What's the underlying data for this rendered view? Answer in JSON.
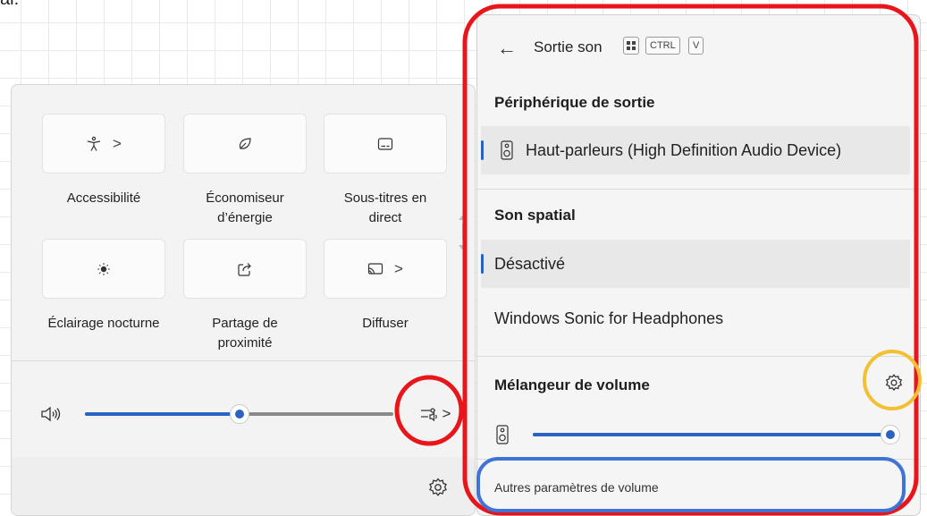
{
  "top_text": "al.",
  "quick_settings": {
    "tiles": [
      {
        "label": "Accessibilité",
        "has_chevron": true,
        "icon": "accessibility-icon"
      },
      {
        "label": "Économiseur d’énergie",
        "has_chevron": false,
        "icon": "leaf-icon"
      },
      {
        "label": "Sous-titres en direct",
        "has_chevron": false,
        "icon": "captions-icon"
      },
      {
        "label": "Éclairage nocturne",
        "has_chevron": false,
        "icon": "brightness-icon"
      },
      {
        "label": "Partage de proximité",
        "has_chevron": false,
        "icon": "share-icon"
      },
      {
        "label": "Diffuser",
        "has_chevron": true,
        "icon": "cast-icon"
      }
    ],
    "chevron": ">",
    "volume": {
      "level": 0.5,
      "icon": "speaker-icon"
    },
    "mixer_chevron": ">"
  },
  "sound_flyout": {
    "back_glyph": "←",
    "title": "Sortie son",
    "shortcut_keys": [
      "CTRL",
      "V"
    ],
    "output_section": "Périphérique de sortie",
    "output_devices": [
      {
        "label": "Haut-parleurs (High Definition Audio Device)",
        "selected": true
      }
    ],
    "spatial_section": "Son spatial",
    "spatial_options": [
      {
        "label": "Désactivé",
        "selected": true
      },
      {
        "label": "Windows Sonic for Headphones",
        "selected": false
      }
    ],
    "mixer_section": "Mélangeur de volume",
    "app_volume": {
      "level": 1.0
    },
    "more_settings_link": "Autres paramètres de volume"
  },
  "annotations": {
    "red": "#e8151b",
    "yellow": "#f2c032",
    "blue": "#3f73d6"
  },
  "colors": {
    "accent": "#2a63c4",
    "panel_bg": "#f3f3f3"
  }
}
